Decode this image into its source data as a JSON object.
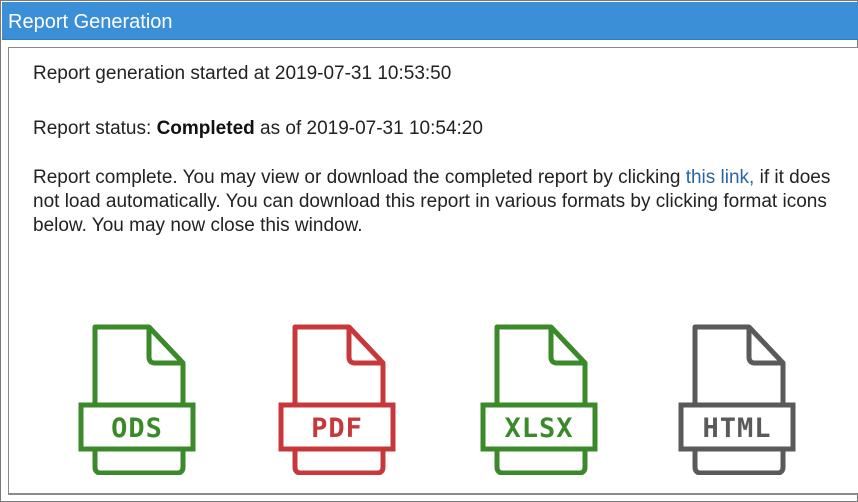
{
  "window": {
    "title": "Report Generation"
  },
  "report": {
    "started_prefix": "Report generation started at ",
    "started_time": "2019-07-31 10:53:50",
    "status_prefix": "Report status: ",
    "status_value": "Completed",
    "status_middle": " as of ",
    "status_time": "2019-07-31 10:54:20",
    "complete_text_1": "Report complete. You may view or download the completed report by clicking",
    "link_text": "this link,",
    "complete_text_2": " if it does not load automatically. You can download this report in various formats by clicking format icons below. You may now close this window."
  },
  "formats": [
    {
      "label": "ODS",
      "icon": "ods-file-icon",
      "color": "#3a8a2a"
    },
    {
      "label": "PDF",
      "icon": "pdf-file-icon",
      "color": "#c8383a"
    },
    {
      "label": "XLSX",
      "icon": "xlsx-file-icon",
      "color": "#3a8a2a"
    },
    {
      "label": "HTML",
      "icon": "html-file-icon",
      "color": "#5a5a5a"
    }
  ]
}
